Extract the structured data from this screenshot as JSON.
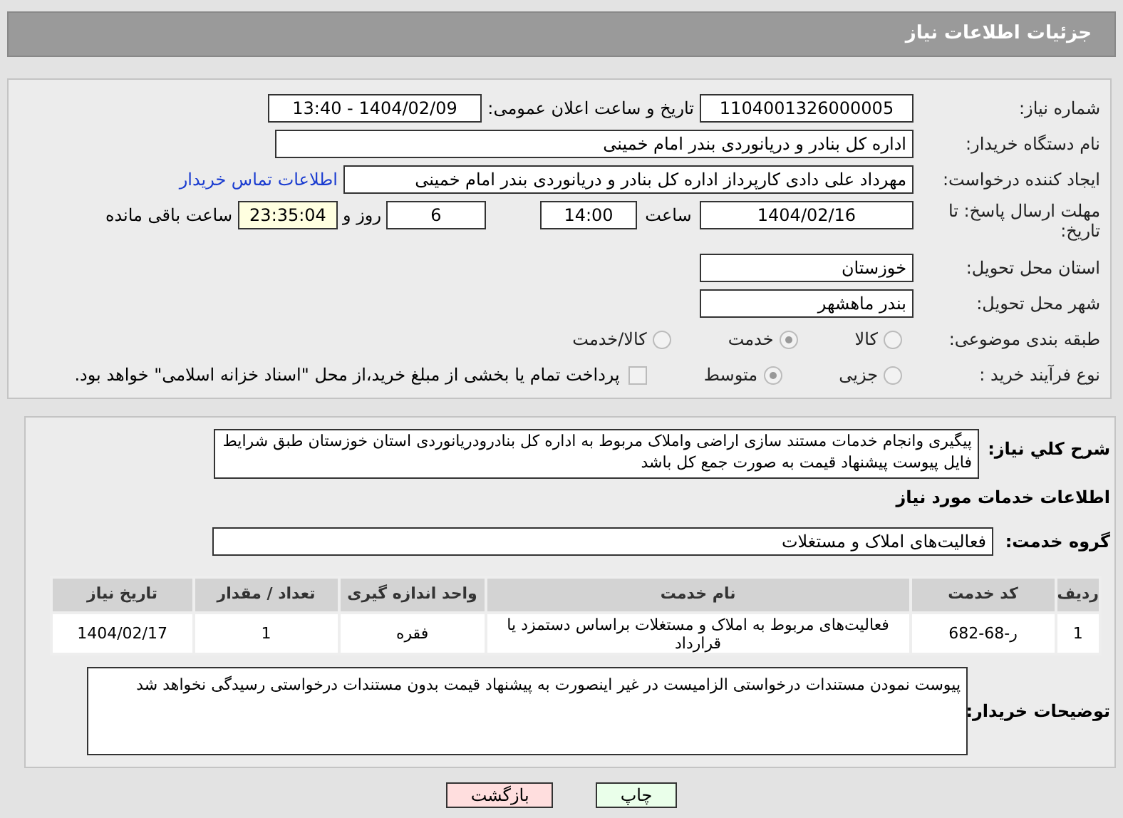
{
  "header": {
    "title": "جزئیات اطلاعات نیاز"
  },
  "need_number": {
    "label": "شماره نیاز:",
    "value": "1104001326000005"
  },
  "announce": {
    "label": "تاریخ و ساعت اعلان عمومی:",
    "value": "1404/02/09 - 13:40"
  },
  "buyer_org": {
    "label": "نام دستگاه خریدار:",
    "value": "اداره کل بنادر و دریانوردی بندر امام خمینی"
  },
  "requester": {
    "label": "ایجاد کننده درخواست:",
    "value": "مهرداد علی دادی کارپرداز اداره کل بنادر و دریانوردی بندر امام خمینی",
    "link": "اطلاعات تماس خریدار"
  },
  "deadline": {
    "label": "مهلت ارسال پاسخ: تا تاریخ:",
    "date": "1404/02/16",
    "time_label": "ساعت",
    "time": "14:00",
    "days": "6",
    "days_label": "روز و",
    "remaining": "23:35:04",
    "remaining_label": "ساعت باقی مانده"
  },
  "province": {
    "label": "استان محل تحویل:",
    "value": "خوزستان"
  },
  "city": {
    "label": "شهر محل تحویل:",
    "value": "بندر ماهشهر"
  },
  "category": {
    "label": "طبقه بندی موضوعی:",
    "options": [
      {
        "label": "کالا",
        "selected": false
      },
      {
        "label": "خدمت",
        "selected": true
      },
      {
        "label": "کالا/خدمت",
        "selected": false
      }
    ]
  },
  "process": {
    "label": "نوع فرآیند خرید :",
    "options": [
      {
        "label": "جزیی",
        "selected": false
      },
      {
        "label": "متوسط",
        "selected": true
      }
    ],
    "payment": {
      "label": "پرداخت تمام یا بخشی از مبلغ خرید،از محل \"اسناد خزانه اسلامی\" خواهد بود.",
      "checked": false
    }
  },
  "description": {
    "label": "شرح کلي نياز:",
    "value": "پیگیری وانجام خدمات مستند سازی اراضی واملاک مربوط به اداره کل بنادرودریانوردی استان خوزستان طبق شرایط فایل پیوست پیشنهاد قیمت به صورت جمع کل باشد"
  },
  "services_title": "اطلاعات خدمات مورد نیاز",
  "service_group": {
    "label": "گروه خدمت:",
    "value": "فعالیت‌های  املاک و مستغلات"
  },
  "table": {
    "columns": [
      "ردیف",
      "کد خدمت",
      "نام خدمت",
      "واحد اندازه گیری",
      "تعداد / مقدار",
      "تاریخ نیاز"
    ],
    "rows": [
      [
        "1",
        "ر-68-682",
        "فعالیت‌های مربوط به املاک و مستغلات براساس دستمزد یا قرارداد",
        "فقره",
        "1",
        "1404/02/17"
      ]
    ]
  },
  "buyer_notes": {
    "label": "توضیحات خریدار:",
    "value": "پیوست نمودن مستندات درخواستی الزامیست در غیر اینصورت به پیشنهاد قیمت بدون مستندات درخواستی رسیدگی نخواهد شد"
  },
  "buttons": [
    {
      "label": "چاپ",
      "kind": "print"
    },
    {
      "label": "بازگشت",
      "kind": "back"
    }
  ]
}
